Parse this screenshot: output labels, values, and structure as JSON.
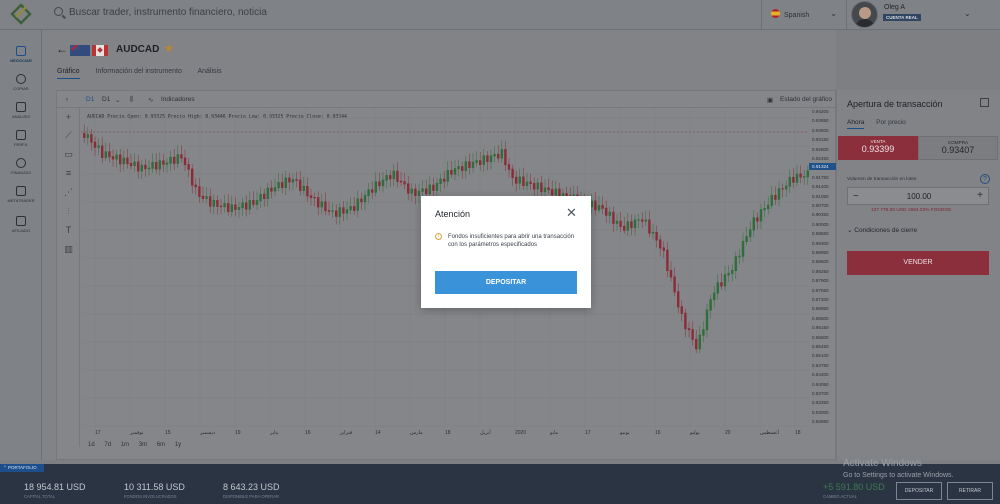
{
  "search": {
    "placeholder": "Buscar trader, instrumento financiero, noticia"
  },
  "language": {
    "label": "Spanish"
  },
  "user": {
    "name": "Oleg A",
    "badge": "CUENTA REAL"
  },
  "nav": [
    {
      "label": "NEGOCIAR",
      "icon": "chart-icon"
    },
    {
      "label": "COPIAR",
      "icon": "copy-people-icon"
    },
    {
      "label": "ANÁLISIS",
      "icon": "analysis-icon"
    },
    {
      "label": "PERFIL",
      "icon": "profile-icon"
    },
    {
      "label": "FINANZAS",
      "icon": "dollar-icon"
    },
    {
      "label": "METATRADER",
      "icon": "monitor-icon"
    },
    {
      "label": "AFILIADO",
      "icon": "affiliate-icon"
    }
  ],
  "instrument": {
    "symbol": "AUDCAD",
    "tabs": [
      "Gráfico",
      "Información del instrumento",
      "Análisis"
    ]
  },
  "chart_toolbar": {
    "interval": "D1",
    "interval2": "D1",
    "indicators": "Indicadores",
    "chart_state": "Estado del gráfico"
  },
  "chart_info": "AUDCAD Precio Open: 0.93325 Precio High: 0.93446 Precio Low: 0.93325 Precio Close: 0.93344",
  "periods": [
    "1d",
    "7d",
    "1m",
    "3m",
    "6m",
    "1y"
  ],
  "chart_data": {
    "type": "candlestick",
    "ylabels": [
      "0.94200",
      "0.93850",
      "0.93500",
      "0.93150",
      "0.92800",
      "0.92450",
      "0.92100",
      "0.91750",
      "0.91400",
      "0.91050",
      "0.90700",
      "0.90350",
      "0.90000",
      "0.89650",
      "0.89300",
      "0.88950",
      "0.88600",
      "0.88250",
      "0.87900",
      "0.87550",
      "0.87200",
      "0.86850",
      "0.86500",
      "0.86150",
      "0.85800",
      "0.85450",
      "0.85100",
      "0.84750",
      "0.84400",
      "0.84050",
      "0.83700",
      "0.83350",
      "0.83000",
      "0.82650"
    ],
    "current_price": "0.91324",
    "xlabels": [
      "17",
      "نوفمبر",
      "15",
      "ديسمبر",
      "19",
      "يناير",
      "16",
      "فبراير",
      "14",
      "مارس",
      "18",
      "أبريل",
      "2020",
      "مايو",
      "17",
      "يونيو",
      "16",
      "يوليو",
      "20",
      "أغسطس",
      "18"
    ]
  },
  "trade_panel": {
    "title": "Apertura de transacción",
    "tabs": [
      "Ahora",
      "Por precio"
    ],
    "sell_label": "VENTA",
    "sell_price": "0.93399",
    "buy_label": "COMPRA",
    "buy_price": "0.93407",
    "volume_label": "Volumen de transacción en lotes",
    "volume": "100.00",
    "margin_info": "137 776.00 USD   1594.03% FONDOS",
    "conditions": "Condiciones de cierre",
    "sell_button": "VENDER"
  },
  "portfolio": {
    "tab": "PORTAFOLIO",
    "stats": [
      {
        "value": "18 954.81 USD",
        "label": "CAPITAL TOTAL"
      },
      {
        "value": "10 311.58 USD",
        "label": "FONDOS INVOLUCRADOS"
      },
      {
        "value": "8 643.23 USD",
        "label": "DISPONIBLE PARA OPERAR"
      }
    ],
    "pl_value": "+5 591.80 USD",
    "pl_label": "CAMBIO ACTUAL",
    "deposit": "DEPOSITAR",
    "withdraw": "RETIRAR"
  },
  "watermark": {
    "title": "Activate Windows",
    "sub": "Go to Settings to activate Windows."
  },
  "modal": {
    "title": "Atención",
    "message": "Fondos insuficientes para abrir una transacción con los parámetros especificados",
    "button": "DEPOSITAR"
  }
}
